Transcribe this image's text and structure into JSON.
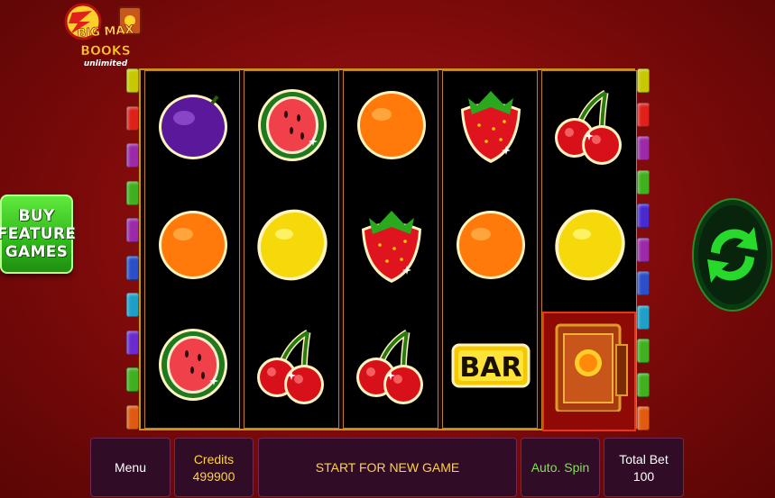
{
  "logo": {
    "line1": "BIG MAX",
    "line2": "BOOKS",
    "line3": "unlimited"
  },
  "buy_feature": {
    "line1": "BUY",
    "line2": "FEATURE",
    "line3": "GAMES"
  },
  "reels": [
    [
      "plum",
      "orange",
      "watermelon"
    ],
    [
      "watermelon",
      "lemon",
      "cherry"
    ],
    [
      "orange",
      "strawberry",
      "cherry"
    ],
    [
      "strawberry",
      "orange",
      "bar"
    ],
    [
      "cherry",
      "lemon",
      "book"
    ]
  ],
  "bar_symbol_text": "BAR",
  "left_indicator_colors": [
    "#c8c800",
    "#e0201a",
    "#9c2aa8",
    "#3fb01e",
    "#9c2aa8",
    "#2a4fc8",
    "#1e9fc8",
    "#6a2ad0",
    "#3fb01e",
    "#e05a10"
  ],
  "right_indicator_colors": [
    "#c8c800",
    "#e0201a",
    "#9c2aa8",
    "#3fb01e",
    "#4a2ad0",
    "#9c2aa8",
    "#2a4fc8",
    "#1e9fc8",
    "#3fb01e",
    "#3fb01e",
    "#e05a10"
  ],
  "bottom_bar": {
    "menu": "Menu",
    "credits_label": "Credits",
    "credits_value": "499900",
    "start": "START FOR NEW GAME",
    "auto_spin": "Auto. Spin",
    "total_bet_label": "Total Bet",
    "total_bet_value": "100"
  },
  "colors": {
    "accent_yellow": "#ffd43a",
    "accent_green": "#79e64b",
    "background": "#7d0a0a"
  },
  "icons": {
    "spin": "spin-arrows-icon"
  }
}
